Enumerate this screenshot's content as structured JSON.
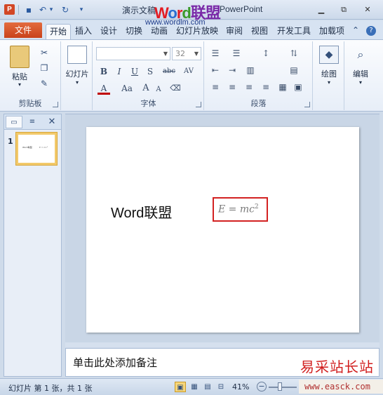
{
  "titlebar": {
    "app_icon": "P",
    "title_left": "演示文稿",
    "title_right": "PowerPoint",
    "watermark_logo": [
      "W",
      "o",
      "r",
      "d",
      "联盟"
    ],
    "watermark_url": "www.wordlm.com",
    "minimize": "▭",
    "restore": "⧉",
    "close": "✕"
  },
  "qat": {
    "save_icon": "💾",
    "undo_icon": "↶",
    "undo_drop": "▾",
    "redo_icon": "↻",
    "customize_icon": "▾"
  },
  "tabs": {
    "file": "文件",
    "items": [
      "开始",
      "插入",
      "设计",
      "切换",
      "动画",
      "幻灯片放映",
      "审阅",
      "视图",
      "开发工具",
      "加载项"
    ],
    "help_icon": "?",
    "collapse_icon": "⌃"
  },
  "ribbon": {
    "clipboard": {
      "label": "剪贴板",
      "paste": "粘贴"
    },
    "slides": {
      "label": "幻灯片",
      "new_slide": "幻灯片"
    },
    "font": {
      "label": "字体",
      "font_name": "",
      "font_size": "32",
      "bold": "B",
      "italic": "I",
      "underline": "U",
      "shadow": "S",
      "strike": "abc",
      "spacing": "AV",
      "font_color": "A",
      "case": "Aa"
    },
    "paragraph": {
      "label": "段落"
    },
    "drawing": {
      "label": "绘图"
    },
    "editing": {
      "label": "编辑"
    }
  },
  "thumbnails": [
    {
      "number": "1",
      "title": "Word联盟",
      "equation": "E = mc²"
    }
  ],
  "slide": {
    "title": "Word联盟",
    "equation_base": "E = mc",
    "equation_exponent": "2",
    "highlight_color": "#d32222"
  },
  "notes": {
    "placeholder": "单击此处添加备注"
  },
  "statusbar": {
    "slide_info": "幻灯片 第 1 张，共 1 张",
    "zoom": "41%",
    "zoom_level_percent": 41
  },
  "site_watermark": {
    "name": "易采站长站",
    "url": "www.easck.com"
  },
  "colors": {
    "accent_file_tab": "#d24726",
    "selected_thumb": "#f2c96b"
  }
}
